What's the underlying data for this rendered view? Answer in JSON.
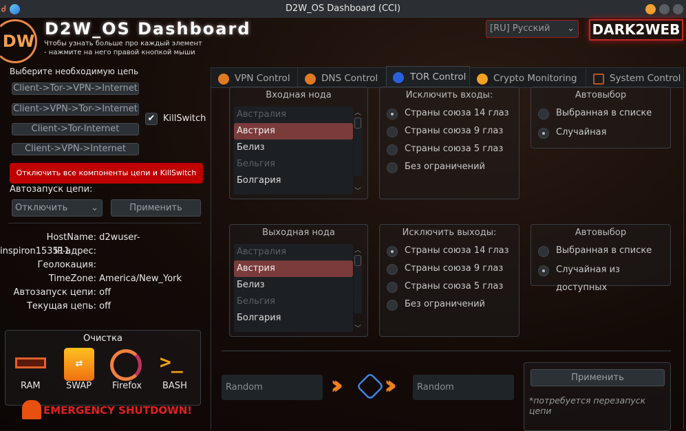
{
  "window": {
    "title": "D2W_OS Dashboard (CCI)"
  },
  "header": {
    "app_title": "D2W_OS Dashboard",
    "hint_line1": "Чтобы узнать больше про каждый элемент",
    "hint_line2": "- нажмите на него правой кнопкой мыши",
    "logo_text": "DW",
    "language": "[RU] Русский",
    "brand": "DARK2WEB"
  },
  "sidebar": {
    "chain_label": "Выберите необходимую цепь",
    "chains": [
      "Client->Tor->VPN->Internet",
      "Client->VPN->Tor->Internet",
      "Client->Tor-Internet",
      "Client->VPN->Internet"
    ],
    "killswitch_label": "KillSwitch",
    "killswitch_checked": true,
    "disable_all": "Отключить все компоненты цепи и KillSwitch",
    "autostart_label": "Автозапуск цепи:",
    "autostart_value": "Отключить",
    "apply": "Применить",
    "info": [
      {
        "label": "HostName:",
        "value": "d2wuser-inspiron153511"
      },
      {
        "label": "IP-адрес:",
        "value": ""
      },
      {
        "label": "Геолокация:",
        "value": ""
      },
      {
        "label": "TimeZone:",
        "value": "America/New_York"
      },
      {
        "label": "Автозапуск цепи:",
        "value": "off"
      },
      {
        "label": "Текущая цепь:",
        "value": "off"
      }
    ],
    "cleanup": {
      "title": "Очистка",
      "items": [
        "RAM",
        "SWAP",
        "Firefox",
        "BASH"
      ]
    },
    "emergency": "EMERGENCY SHUTDOWN!"
  },
  "tabs": [
    {
      "label": "VPN Control"
    },
    {
      "label": "DNS Control"
    },
    {
      "label": "TOR Control",
      "active": true
    },
    {
      "label": "Crypto Monitoring"
    },
    {
      "label": "System Control"
    }
  ],
  "tor": {
    "entry": {
      "title": "Входная нода",
      "countries": [
        "Австралия",
        "Австрия",
        "Белиз",
        "Бельгия",
        "Болгария"
      ],
      "selected": "Австрия",
      "exclude_title": "Исключить входы:",
      "exclude_options": [
        "Страны союза 14 глаз",
        "Страны союза 9 глаз",
        "Страны союза 5 глаз",
        "Без ограничений"
      ],
      "exclude_selected": 0,
      "auto_title": "Автовыбор",
      "auto_options": [
        "Выбранная в списке",
        "Случайная"
      ],
      "auto_selected": 1
    },
    "exit": {
      "title": "Выходная нода",
      "countries": [
        "Австралия",
        "Австрия",
        "Белиз",
        "Бельгия",
        "Болгария"
      ],
      "selected": "Австрия",
      "exclude_title": "Исключить выходы:",
      "exclude_options": [
        "Страны союза 14 глаз",
        "Страны союза 9 глаз",
        "Страны союза 5 глаз",
        "Без ограничений"
      ],
      "exclude_selected": 0,
      "auto_title": "Автовыбор",
      "auto_options": [
        "Выбранная в списке",
        "Случайная из доступных"
      ],
      "auto_selected": 1
    },
    "entry_value": "Random",
    "exit_value": "Random",
    "apply": "Применить",
    "note": "*потребуется перезапуск цепи"
  }
}
